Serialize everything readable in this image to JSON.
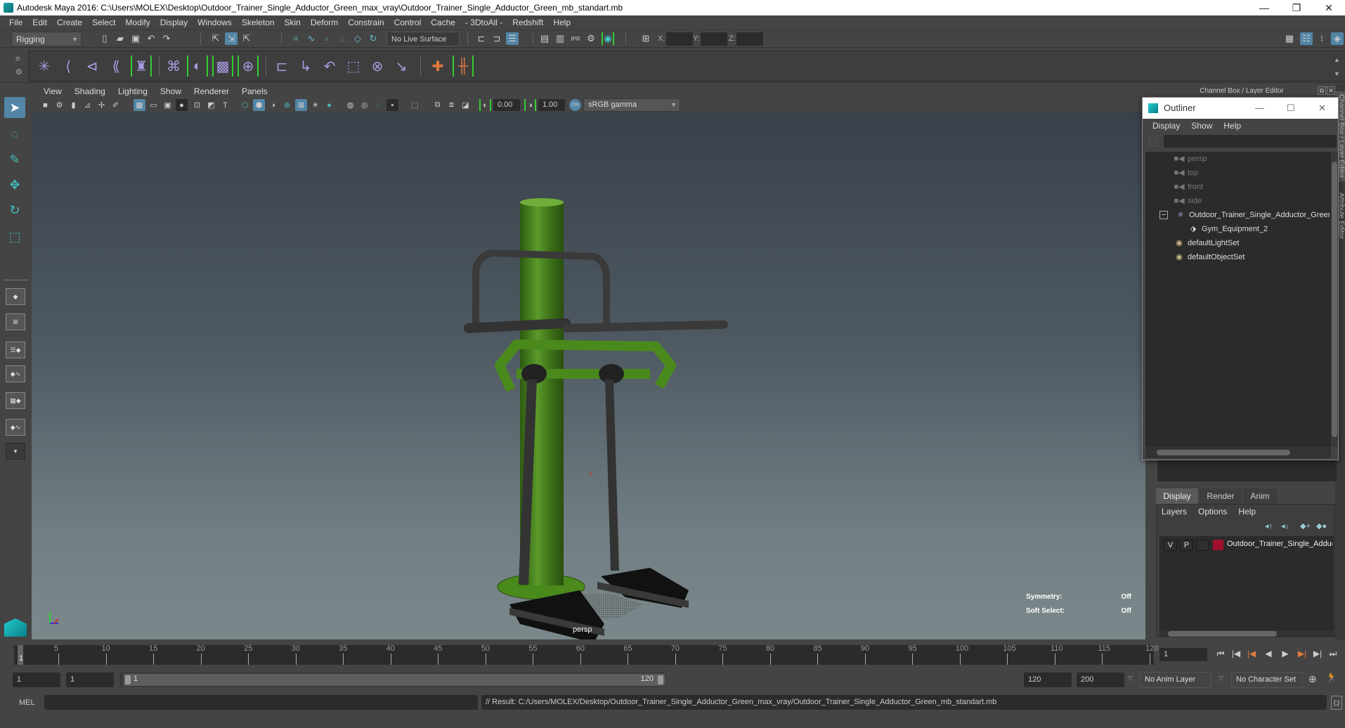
{
  "window": {
    "title": "Autodesk Maya 2016: C:\\Users\\MOLEX\\Desktop\\Outdoor_Trainer_Single_Adductor_Green_max_vray\\Outdoor_Trainer_Single_Adductor_Green_mb_standart.mb",
    "minimize": "—",
    "restore": "❐",
    "close": "✕"
  },
  "menubar": [
    "File",
    "Edit",
    "Create",
    "Select",
    "Modify",
    "Display",
    "Windows",
    "Skeleton",
    "Skin",
    "Deform",
    "Constrain",
    "Control",
    "Cache",
    "- 3DtoAll -",
    "Redshift",
    "Help"
  ],
  "status_line": {
    "menu_set": "Rigging",
    "live_surface": "No Live Surface",
    "x_label": "X:",
    "y_label": "Y:",
    "z_label": "Z:",
    "x_value": "",
    "y_value": "",
    "z_value": ""
  },
  "panel": {
    "menu": [
      "View",
      "Shading",
      "Lighting",
      "Show",
      "Renderer",
      "Panels"
    ],
    "exposure": "0.00",
    "gamma": "1.00",
    "color_space": "sRGB gamma"
  },
  "viewport": {
    "camera": "persp",
    "hud": [
      {
        "label": "Symmetry:",
        "value": "Off"
      },
      {
        "label": "Soft Select:",
        "value": "Off"
      }
    ],
    "object_colors": {
      "frame": "#4a8a1c",
      "bars": "#3a3a3a",
      "pedals": "#111111"
    }
  },
  "channel_box": {
    "header": "Channel Box / Layer Editor",
    "side_tabs": [
      "Channel Box / Layer Editor",
      "Attribute Editor"
    ]
  },
  "outliner": {
    "title": "Outliner",
    "menu": [
      "Display",
      "Show",
      "Help"
    ],
    "items": [
      {
        "label": "persp",
        "icon": "camera-icon",
        "dim": true
      },
      {
        "label": "top",
        "icon": "camera-icon",
        "dim": true
      },
      {
        "label": "front",
        "icon": "camera-icon",
        "dim": true
      },
      {
        "label": "side",
        "icon": "camera-icon",
        "dim": true
      },
      {
        "label": "Outdoor_Trainer_Single_Adductor_Green",
        "icon": "group-icon",
        "expanded": true
      },
      {
        "label": "Gym_Equipment_2",
        "icon": "mesh-icon",
        "child": true
      },
      {
        "label": "defaultLightSet",
        "icon": "set-icon"
      },
      {
        "label": "defaultObjectSet",
        "icon": "set-icon"
      }
    ]
  },
  "layer_editor": {
    "tabs": [
      "Display",
      "Render",
      "Anim"
    ],
    "active_tab": "Display",
    "menu": [
      "Layers",
      "Options",
      "Help"
    ],
    "layers": [
      {
        "v": "V",
        "p": "P",
        "color": "#a0102a",
        "name": "Outdoor_Trainer_Single_Adductor_Green"
      }
    ]
  },
  "timeline": {
    "ticks": [
      5,
      10,
      15,
      20,
      25,
      30,
      35,
      40,
      45,
      50,
      55,
      60,
      65,
      70,
      75,
      80,
      85,
      90,
      95,
      100,
      105,
      110,
      115,
      120
    ],
    "current_frame": "1",
    "current_frame_field": "1"
  },
  "range": {
    "start": "1",
    "playback_start": "1",
    "slider_start": "1",
    "slider_end": "120",
    "playback_end": "120",
    "end": "200",
    "anim_layer": "No Anim Layer",
    "character_set": "No Character Set"
  },
  "command_line": {
    "language": "MEL",
    "input": "",
    "result": "// Result: C:/Users/MOLEX/Desktop/Outdoor_Trainer_Single_Adductor_Green_max_vray/Outdoor_Trainer_Single_Adductor_Green_mb_standart.mb"
  }
}
